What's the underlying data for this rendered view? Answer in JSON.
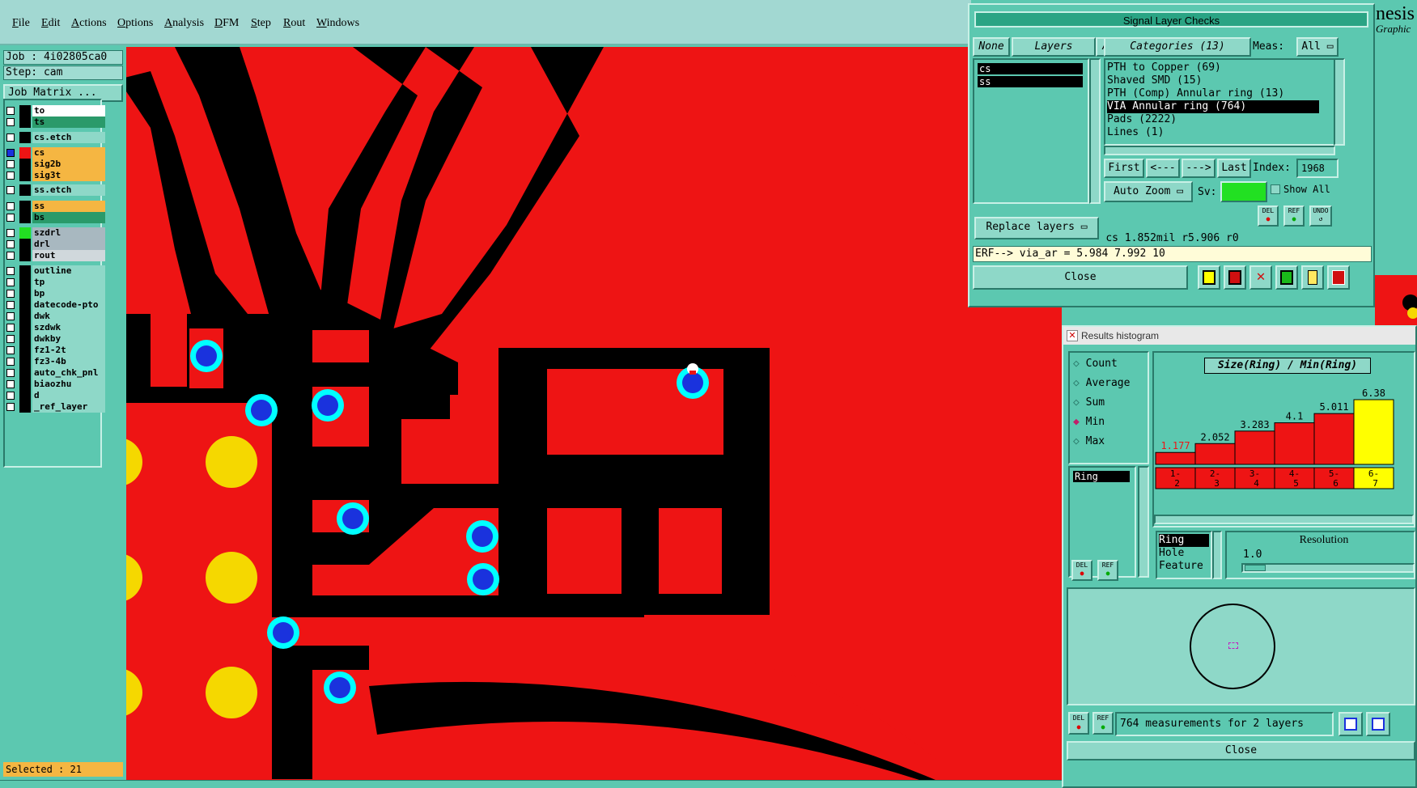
{
  "menu": {
    "items": [
      "File",
      "Edit",
      "Actions",
      "Options",
      "Analysis",
      "DFM",
      "Step",
      "Rout",
      "Windows"
    ]
  },
  "job": {
    "job_label": "Job : 4i02805ca0",
    "step_label": "Step: cam",
    "matrix_button": "Job Matrix ..."
  },
  "layers": [
    {
      "name": "to",
      "color": "#ffffff"
    },
    {
      "name": "ts",
      "color": "#2a9a6a"
    },
    {
      "name": "cs.etch",
      "color": "#8ed8c8"
    },
    {
      "name": "cs",
      "color": "#f5b642"
    },
    {
      "name": "sig2b",
      "color": "#f5b642"
    },
    {
      "name": "sig3t",
      "color": "#f5b642"
    },
    {
      "name": "ss.etch",
      "color": "#8ed8c8"
    },
    {
      "name": "ss",
      "color": "#f5b642"
    },
    {
      "name": "bs",
      "color": "#2a9a6a"
    },
    {
      "name": "szdrl",
      "color": "#a8b8c0"
    },
    {
      "name": "drl",
      "color": "#a8b8c0"
    },
    {
      "name": "rout",
      "color": "#d0d8dc"
    },
    {
      "name": "outline",
      "color": "#8ed8c8"
    },
    {
      "name": "tp",
      "color": "#8ed8c8"
    },
    {
      "name": "bp",
      "color": "#8ed8c8"
    },
    {
      "name": "datecode-pto",
      "color": "#8ed8c8"
    },
    {
      "name": "dwk",
      "color": "#8ed8c8"
    },
    {
      "name": "szdwk",
      "color": "#8ed8c8"
    },
    {
      "name": "dwkby",
      "color": "#8ed8c8"
    },
    {
      "name": "fz1-2t",
      "color": "#8ed8c8"
    },
    {
      "name": "fz3-4b",
      "color": "#8ed8c8"
    },
    {
      "name": "auto_chk_pnl",
      "color": "#8ed8c8"
    },
    {
      "name": "biaozhu",
      "color": "#8ed8c8"
    },
    {
      "name": "d",
      "color": "#8ed8c8"
    },
    {
      "name": "_ref_layer",
      "color": "#8ed8c8"
    }
  ],
  "status": {
    "selected": "Selected : 21"
  },
  "signal_checks": {
    "title": "Signal Layer Checks",
    "none_btn": "None",
    "layers_btn": "Layers",
    "all_btn": "All",
    "layer_list": [
      "cs",
      "ss"
    ],
    "categories_label": "Categories (13)",
    "meas_label": "Meas:",
    "meas_value": "All",
    "categories": [
      "PTH to Copper (69)",
      "Shaved SMD (15)",
      "PTH (Comp) Annular ring (13)",
      "VIA Annular ring (764)",
      "Pads (2222)",
      "Lines (1)"
    ],
    "selected_category": "VIA Annular ring (764)",
    "first_btn": "First",
    "prev_btn": "<---",
    "next_btn": "--->",
    "last_btn": "Last",
    "index_label": "Index:",
    "index_value": "1968",
    "zoom_btn": "Auto Zoom",
    "sv_label": "Sv:",
    "show_all": "Show All",
    "replace_btn": "Replace layers",
    "info_line": "cs 1.852mil  r5.906  r0",
    "erf_line": "ERF--> via_ar = 5.984 7.992 10",
    "close_btn": "Close",
    "del": "DEL",
    "ref": "REF",
    "undo": "UNDO"
  },
  "histogram": {
    "title": "Results histogram",
    "modes": [
      "Count",
      "Average",
      "Sum",
      "Min",
      "Max"
    ],
    "selected_mode": "Min",
    "chart_title": "Size(Ring) / Min(Ring)",
    "measure_list": [
      "Ring"
    ],
    "attr_list": [
      "Ring",
      "Hole",
      "Feature"
    ],
    "resolution_label": "Resolution",
    "resolution_value": "1.0",
    "status_text": "764 measurements for 2 layers",
    "close_btn": "Close",
    "del": "DEL",
    "ref": "REF",
    "brand_text": "nesis",
    "brand_sub": "Graphic"
  },
  "chart_data": {
    "type": "bar",
    "categories": [
      "1-2",
      "2-3",
      "3-4",
      "4-5",
      "5-6",
      "6-7"
    ],
    "values": [
      1.177,
      2.052,
      3.283,
      4.1,
      5.011,
      6.38
    ],
    "title": "Size(Ring) / Min(Ring)",
    "xlabel": "",
    "ylabel": ""
  }
}
